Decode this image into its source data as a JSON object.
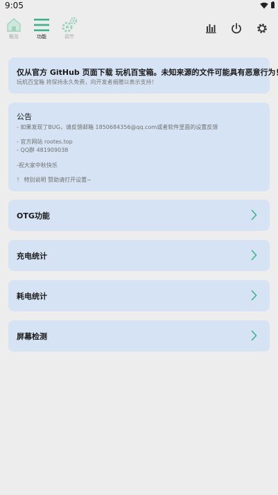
{
  "status_bar": {
    "time": "9:05",
    "icons": [
      "wifi-icon",
      "battery-icon"
    ]
  },
  "nav": {
    "tabs": [
      {
        "label": "概览",
        "icon": "home-icon",
        "active": false
      },
      {
        "label": "功能",
        "icon": "menu-icon",
        "active": true
      },
      {
        "label": "调节",
        "icon": "gears-icon",
        "active": false
      }
    ],
    "actions": [
      "bar-chart-icon",
      "power-icon",
      "settings-gear-icon"
    ]
  },
  "notice": {
    "main": "仅从官方 GitHub 页面下载 玩机百宝箱。未知来源的文件可能具有恶意行为！",
    "sub": "玩机百宝箱 将保持永久免费，向开发者捐赠以表示支持！"
  },
  "announcement": {
    "title": "公告",
    "lines": [
      "- 如果发现了BUG，请反馈邮箱 1850684356@qq.com或者软件里面的设置反馈",
      "- 官方网站 rootes.top",
      "- QQ群 481909038",
      "-祝大家中秋快乐",
      "！ 特别说明 赞助请打开设置~"
    ]
  },
  "features": [
    {
      "label": "OTG功能"
    },
    {
      "label": "充电统计"
    },
    {
      "label": "耗电统计"
    },
    {
      "label": "屏幕检测"
    }
  ],
  "colors": {
    "accent": "#3bb38a",
    "card": "#d6e3f4",
    "background": "#ededed"
  }
}
